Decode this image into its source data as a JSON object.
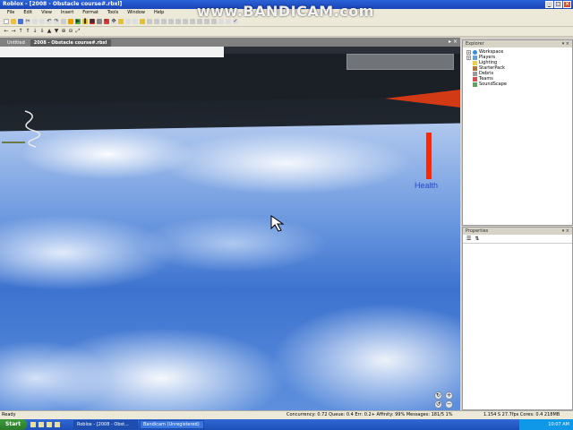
{
  "window": {
    "title": "Roblox - [2008 - Obstacle course#.rbxl]",
    "controls": [
      "_",
      "□",
      "×"
    ]
  },
  "menu": [
    "File",
    "Edit",
    "View",
    "Insert",
    "Format",
    "Tools",
    "Window",
    "Help"
  ],
  "tabs": [
    {
      "label": "Untitled",
      "active": false
    },
    {
      "label": "2008 - Obstacle course#.rbxl",
      "active": true
    }
  ],
  "viewport": {
    "health_label": "Health",
    "health_level_percent": 100,
    "colors": {
      "health": "#f32a0c",
      "health_text": "#2447ce",
      "cone": "#d23a16",
      "sky": "#4d84d8"
    }
  },
  "explorer": {
    "title": "Explorer",
    "items": [
      {
        "label": "Workspace",
        "expander": "+",
        "icon": "globe-icon"
      },
      {
        "label": "Players",
        "expander": "+",
        "icon": "players-icon"
      },
      {
        "label": "Lighting",
        "expander": "",
        "icon": "lighting-icon"
      },
      {
        "label": "StarterPack",
        "expander": "",
        "icon": "pack-icon"
      },
      {
        "label": "Debris",
        "expander": "",
        "icon": "debris-icon"
      },
      {
        "label": "Teams",
        "expander": "",
        "icon": "teams-icon"
      },
      {
        "label": "SoundScape",
        "expander": "",
        "icon": "sound-icon"
      }
    ]
  },
  "properties": {
    "title": "Properties"
  },
  "status": {
    "left": "Ready",
    "middle": "Concurrency: 0.72  Queue: 0.4  Err: 0.2+  Affinity: 99% Messages: 181/5 1%",
    "right": "1.154 S   27.7fps   Cores: 0.4      218MB"
  },
  "taskbar": {
    "start": "Start",
    "tasks": [
      {
        "label": "Roblox - [2008 - Obst...",
        "active": true
      },
      {
        "label": "Bandicam (Unregistered)",
        "active": false
      }
    ],
    "clock": "10:07 AM"
  },
  "watermark": "www.BANDICAM.com"
}
